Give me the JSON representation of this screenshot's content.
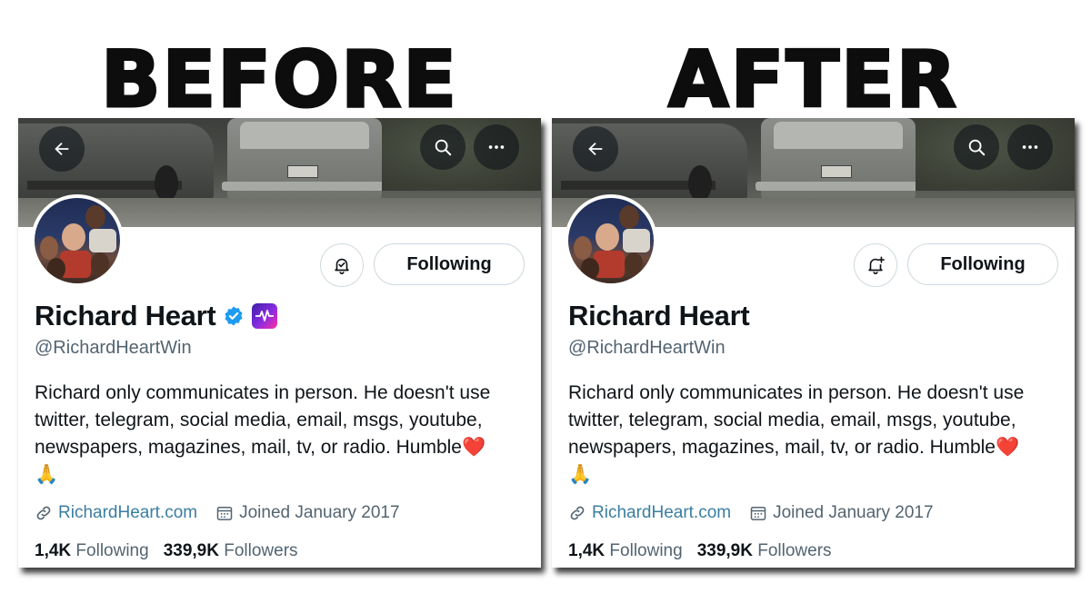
{
  "labels": {
    "before": "BEFORE",
    "after": "AFTER"
  },
  "before": {
    "profile": {
      "name": "Richard Heart",
      "handle": "@RichardHeartWin",
      "bio_lines": [
        "Richard only communicates in person. He doesn't use",
        "twitter, telegram, social media, email, msgs, youtube,",
        "newspapers, magazines, mail, tv, or radio. Humble❤️",
        "🙏"
      ],
      "link": "RichardHeart.com",
      "joined": "Joined January 2017",
      "following_count": "1,4K",
      "following_label": "Following",
      "followers_count": "339,9K",
      "followers_label": "Followers",
      "follow_button": "Following",
      "verified": true,
      "affiliate_badge": true,
      "bell_icon": "bell-subscribed-icon"
    }
  },
  "after": {
    "profile": {
      "name": "Richard Heart",
      "handle": "@RichardHeartWin",
      "bio_lines": [
        "Richard only communicates in person. He doesn't use",
        "twitter, telegram, social media, email, msgs, youtube,",
        "newspapers, magazines, mail, tv, or radio. Humble❤️",
        "🙏"
      ],
      "link": "RichardHeart.com",
      "joined": "Joined January 2017",
      "following_count": "1,4K",
      "following_label": "Following",
      "followers_count": "339,9K",
      "followers_label": "Followers",
      "follow_button": "Following",
      "verified": false,
      "affiliate_badge": false,
      "bell_icon": "bell-plus-icon"
    }
  },
  "colors": {
    "text_primary": "#0f1419",
    "text_secondary": "#536471",
    "link": "#3a7ea1",
    "verified": "#1d9bf0",
    "border": "#cfd9de"
  }
}
